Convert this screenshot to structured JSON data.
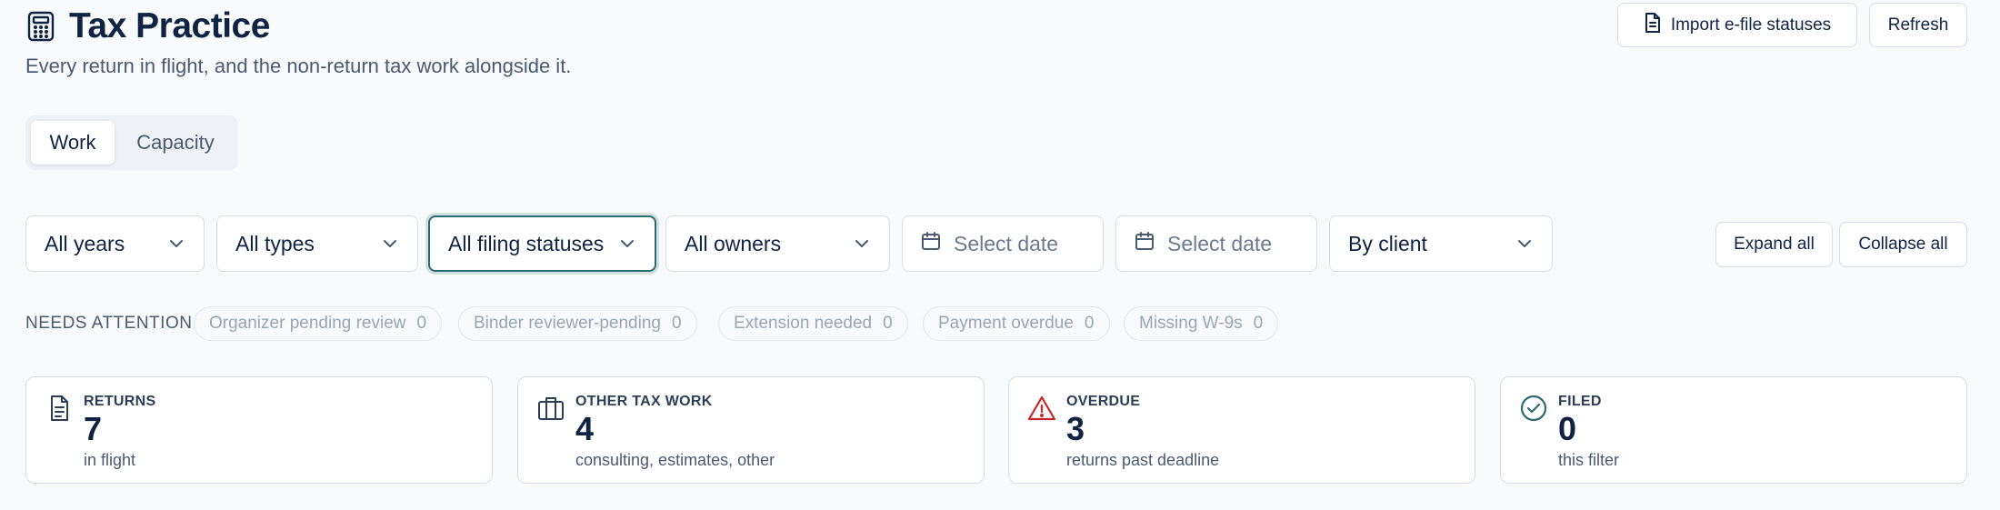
{
  "header": {
    "title": "Tax Practice",
    "subtitle": "Every return in flight, and the non-return tax work alongside it.",
    "import_label": "Import e-file statuses",
    "refresh_label": "Refresh"
  },
  "tabs": [
    {
      "label": "Work",
      "active": true
    },
    {
      "label": "Capacity",
      "active": false
    }
  ],
  "filters": {
    "years": "All years",
    "types": "All types",
    "filing_statuses": "All filing statuses",
    "owners": "All owners",
    "date_from_placeholder": "Select date",
    "date_to_placeholder": "Select date",
    "grouping": "By client"
  },
  "actions": {
    "expand_all": "Expand all",
    "collapse_all": "Collapse all"
  },
  "needs_attention": {
    "label": "NEEDS ATTENTION",
    "chips": [
      {
        "label": "Organizer pending review",
        "count": "0"
      },
      {
        "label": "Binder reviewer-pending",
        "count": "0"
      },
      {
        "label": "Extension needed",
        "count": "0"
      },
      {
        "label": "Payment overdue",
        "count": "0"
      },
      {
        "label": "Missing W-9s",
        "count": "0"
      }
    ]
  },
  "stats": [
    {
      "label": "RETURNS",
      "value": "7",
      "sub": "in flight",
      "icon": "document-icon"
    },
    {
      "label": "OTHER TAX WORK",
      "value": "4",
      "sub": "consulting, estimates, other",
      "icon": "briefcase-icon"
    },
    {
      "label": "OVERDUE",
      "value": "3",
      "sub": "returns past deadline",
      "icon": "warning-icon"
    },
    {
      "label": "FILED",
      "value": "0",
      "sub": "this filter",
      "icon": "check-circle-icon"
    }
  ],
  "colors": {
    "primary_text": "#0f2342",
    "accent_teal": "#2e6a70",
    "danger": "#c62828",
    "background": "#f8fafc"
  }
}
